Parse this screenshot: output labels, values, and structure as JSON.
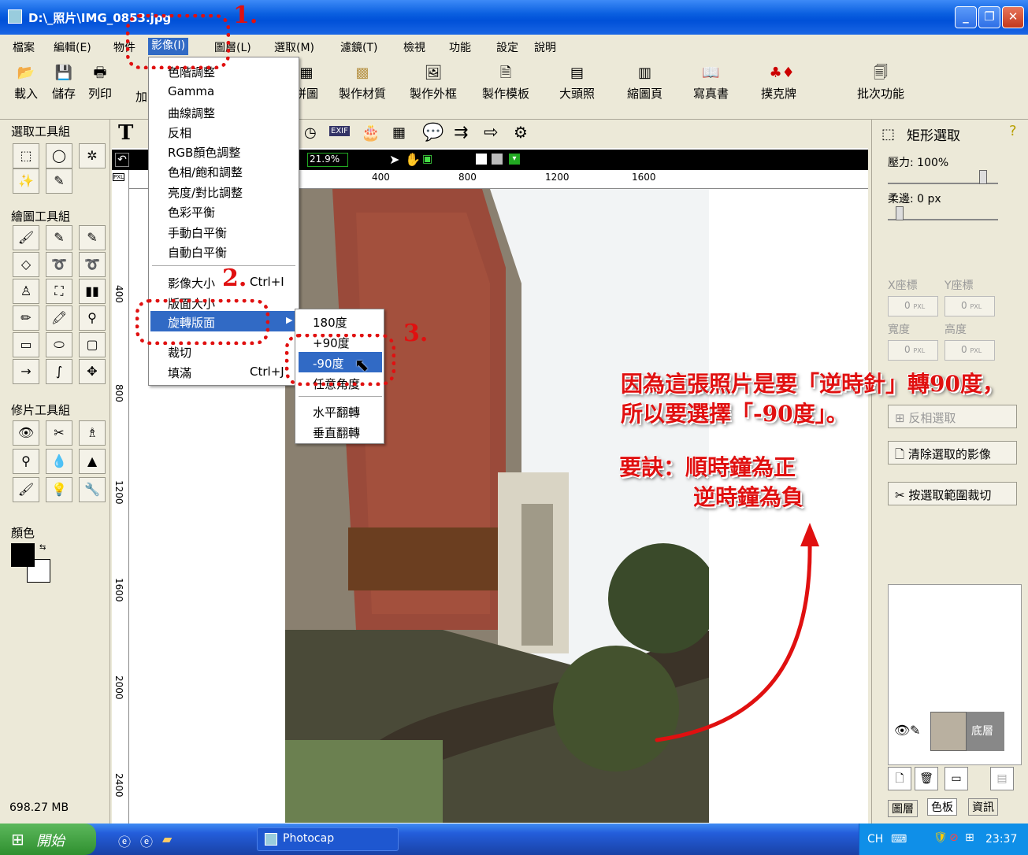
{
  "window": {
    "title": "D:\\_照片\\IMG_0853.jpg"
  },
  "menubar": [
    "檔案",
    "編輯(E)",
    "物件",
    "影像(I)",
    "圖層(L)",
    "選取(M)",
    "濾鏡(T)",
    "檢視",
    "功能",
    "設定",
    "說明"
  ],
  "toolbar": [
    "載入",
    "儲存",
    "列印",
    "加",
    "拼圖",
    "製作材質",
    "製作外框",
    "製作模板",
    "大頭照",
    "縮圖頁",
    "寫真書",
    "撲克牌",
    "批次功能"
  ],
  "left_panel": {
    "select_group": "選取工具組",
    "draw_group": "繪圖工具組",
    "retouch_group": "修片工具組",
    "color_label": "顏色",
    "memory": "698.27 MB"
  },
  "zoom": "21.9%",
  "ruler_units": "PXL",
  "ruler_top": [
    "400",
    "800",
    "1200",
    "1600"
  ],
  "ruler_left": [
    "400",
    "800",
    "1200",
    "1600",
    "2000",
    "2400"
  ],
  "image_menu": {
    "items": [
      "色階調整",
      "Gamma",
      "曲線調整",
      "反相",
      "RGB顏色調整",
      "色相/飽和調整",
      "亮度/對比調整",
      "色彩平衡",
      "手動白平衡",
      "自動白平衡"
    ],
    "items2": [
      {
        "label": "影像大小",
        "shortcut": "Ctrl+I"
      },
      {
        "label": "版面大小",
        "shortcut": ""
      },
      {
        "label": "旋轉版面",
        "shortcut": ""
      },
      {
        "label": "裁切",
        "shortcut": ""
      },
      {
        "label": "填滿",
        "shortcut": "Ctrl+J"
      }
    ]
  },
  "rotate_submenu": [
    "180度",
    "+90度",
    "-90度",
    "任意角度",
    "水平翻轉",
    "垂直翻轉"
  ],
  "right_panel": {
    "title": "矩形選取",
    "pressure": "壓力: 100%",
    "feather": "柔邊: 0 px",
    "x_label": "X座標",
    "y_label": "Y座標",
    "w_label": "寬度",
    "h_label": "高度",
    "zero": "0",
    "unit": "PXL",
    "invert": "反相選取",
    "clear": "清除選取的影像",
    "crop": "按選取範圍裁切",
    "layer_name": "底層",
    "tabs": [
      "圖層",
      "色板",
      "資訊"
    ]
  },
  "annotations": {
    "steps": [
      "1.",
      "2.",
      "3."
    ],
    "note1": "因為這張照片是要「逆時針」轉90度，",
    "note2": "所以要選擇「-90度」。",
    "tip1": "要訣：順時鐘為正",
    "tip2": "逆時鐘為負"
  },
  "taskbar": {
    "start": "開始",
    "app": "Photocap",
    "lang": "CH",
    "time": "23:37"
  }
}
